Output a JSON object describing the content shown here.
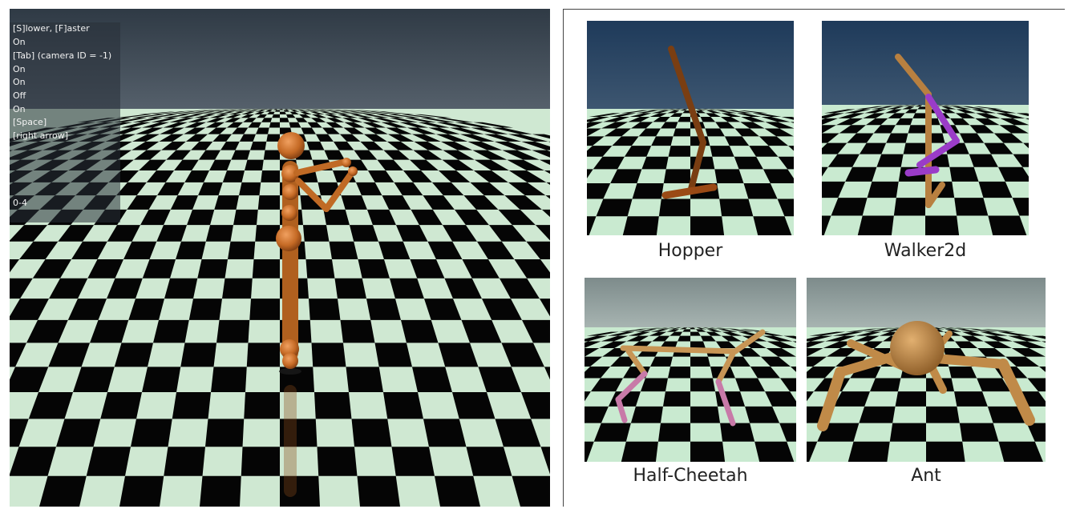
{
  "viewer": {
    "overlay_lines": [
      "[S]lower, [F]aster",
      "On",
      "[Tab] (camera ID = -1)",
      "On",
      "On",
      "Off",
      "On",
      "[Space]",
      "[right arrow]"
    ],
    "frame_label": "0-4",
    "figure": "humanoid"
  },
  "panels": [
    {
      "caption": "Hopper",
      "scene": "hopper"
    },
    {
      "caption": "Walker2d",
      "scene": "walker2d"
    },
    {
      "caption": "Half-Cheetah",
      "scene": "half-cheetah"
    },
    {
      "caption": "Ant",
      "scene": "ant"
    }
  ],
  "colors": {
    "sky_top": "#2a3f55",
    "sky_bottom": "#4a5d70",
    "tile_light": "#c9ead0",
    "tile_dark": "#050505",
    "body_orange": "#c8742f",
    "body_tan": "#c79555",
    "limb_purple": "#9a3cc8",
    "limb_pink": "#c87aa8"
  }
}
